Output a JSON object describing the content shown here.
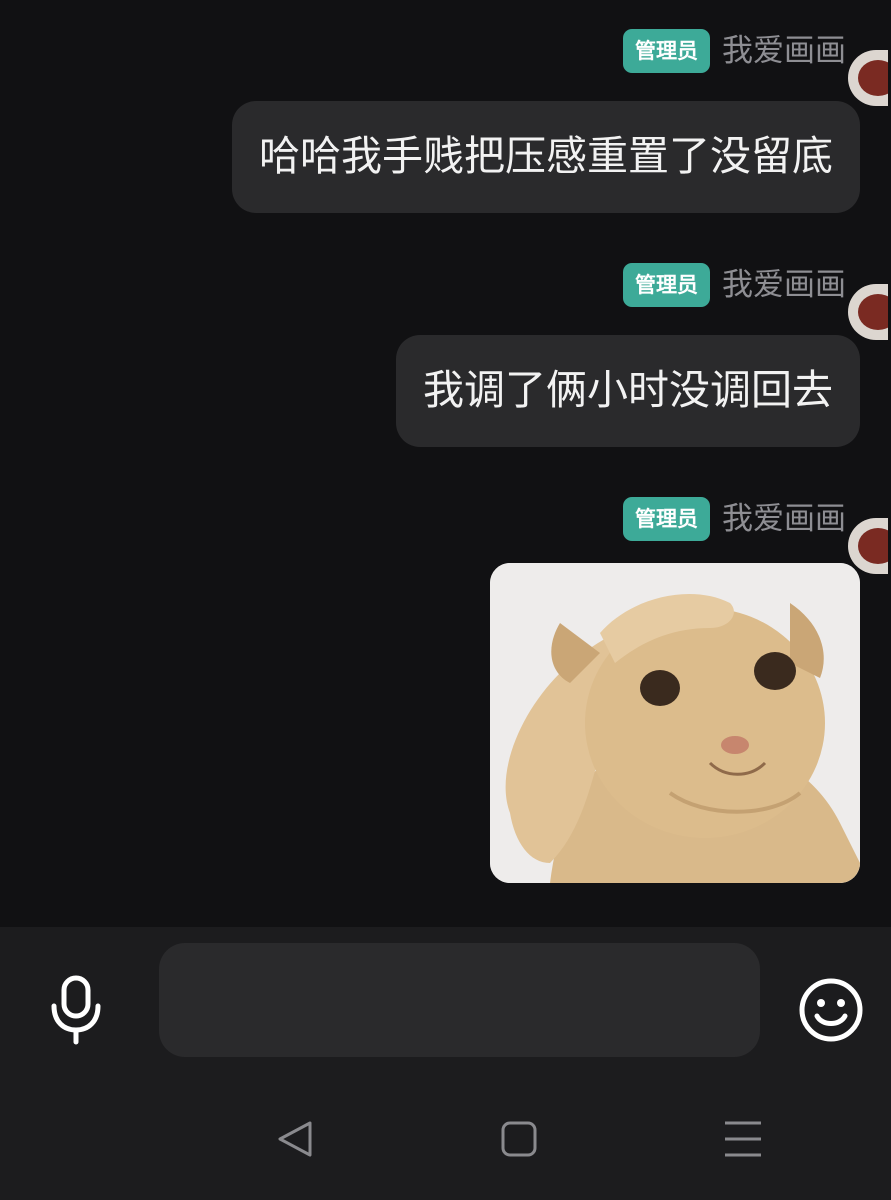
{
  "messages": [
    {
      "badge": "管理员",
      "sender": "我爱画画",
      "text": "哈哈我手贱把压感重置了没留底"
    },
    {
      "badge": "管理员",
      "sender": "我爱画画",
      "text": "我调了俩小时没调回去"
    },
    {
      "badge": "管理员",
      "sender": "我爱画画",
      "image": "cat-meme-sticker"
    }
  ],
  "input": {
    "value": "",
    "placeholder": ""
  },
  "icons": {
    "voice": "microphone-icon",
    "emoji": "smiley-icon",
    "back": "triangle-back-icon",
    "home": "square-home-icon",
    "menu": "three-lines-menu-icon"
  },
  "colors": {
    "background": "#111113",
    "bubble": "#2a2a2c",
    "badge": "#3daa98",
    "sender_name": "#8e8e93",
    "input_bar": "#1c1c1e"
  }
}
